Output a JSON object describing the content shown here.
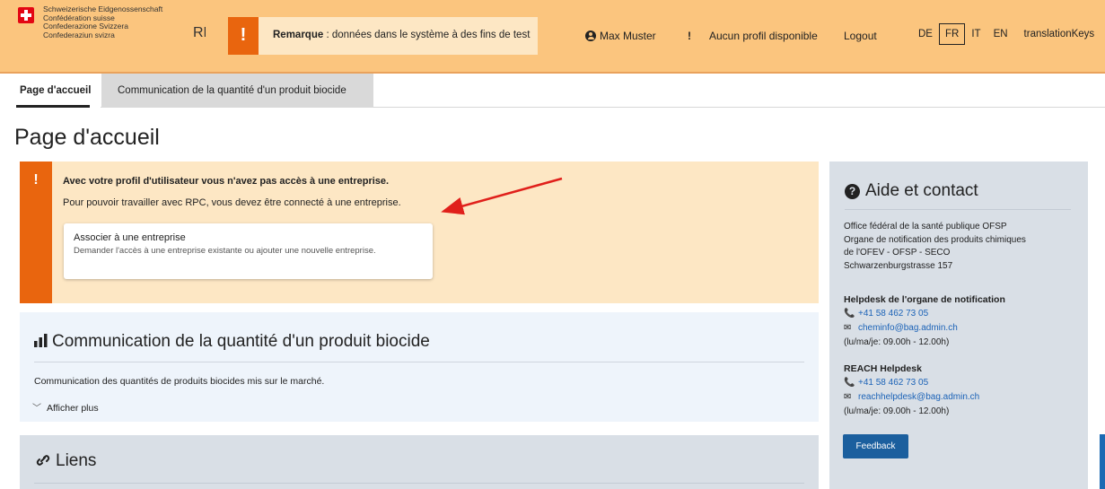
{
  "header": {
    "confederation": [
      "Schweizerische Eidgenossenschaft",
      "Confédération suisse",
      "Confederazione Svizzera",
      "Confederaziun svizra"
    ],
    "app_abbr": "RPC",
    "notice_bang": "!",
    "notice_bold": "Remarque",
    "notice_text": " : données dans le système à des fins de test",
    "user_name": "Max Muster",
    "profile_warn": "!",
    "profile_text": "Aucun profil disponible",
    "logout": "Logout",
    "languages": [
      "DE",
      "FR",
      "IT",
      "EN"
    ],
    "active_language": "FR",
    "translation_keys": "translationKeys"
  },
  "tabs": [
    {
      "label": "Page d'accueil",
      "active": true
    },
    {
      "label": "Communication de la quantité d'un produit biocide",
      "active": false
    }
  ],
  "page_title": "Page d'accueil",
  "warning": {
    "bang": "!",
    "line1": "Avec votre profil d'utilisateur vous n'avez pas accès à une entreprise.",
    "line2": "Pour pouvoir travailler avec RPC, vous devez être connecté à une entreprise.",
    "card_title": "Associer à une entreprise",
    "card_desc": "Demander l'accès à une entreprise existante ou ajouter une nouvelle entreprise."
  },
  "biocide": {
    "title": "Communication de la quantité d'un produit biocide",
    "description": "Communication des quantités de produits biocides mis sur le marché.",
    "show_more": "Afficher plus"
  },
  "links": {
    "title": "Liens"
  },
  "aide": {
    "title": "Aide et contact",
    "address": [
      "Office fédéral de la santé publique OFSP",
      "Organe de notification des produits chimiques",
      "de l'OFEV - OFSP - SECO",
      "Schwarzenburgstrasse 157"
    ],
    "helpdesk1": {
      "heading": "Helpdesk de l'organe de notification",
      "phone": "+41 58 462 73 05",
      "email": "cheminfo@bag.admin.ch",
      "hours": "(lu/ma/je: 09.00h - 12.00h)"
    },
    "helpdesk2": {
      "heading": "REACH Helpdesk",
      "phone": "+41 58 462 73 05",
      "email": "reachhelpdesk@bag.admin.ch",
      "hours": "(lu/ma/je: 09.00h - 12.00h)"
    },
    "feedback": "Feedback"
  },
  "colors": {
    "header_bg": "#fbc57e",
    "warning_accent": "#e9650e",
    "warning_bg": "#fde7c4",
    "link": "#1c63b7",
    "button": "#1b5f9e",
    "annotation_arrow": "#e0201b"
  },
  "icons": {
    "flag": "swiss-flag-icon",
    "user": "user-circle-icon",
    "chart": "bar-chart-icon",
    "link": "link-icon",
    "help": "question-circle-icon",
    "phone": "phone-icon",
    "email": "envelope-icon",
    "expand": "chevron-down-icon"
  }
}
